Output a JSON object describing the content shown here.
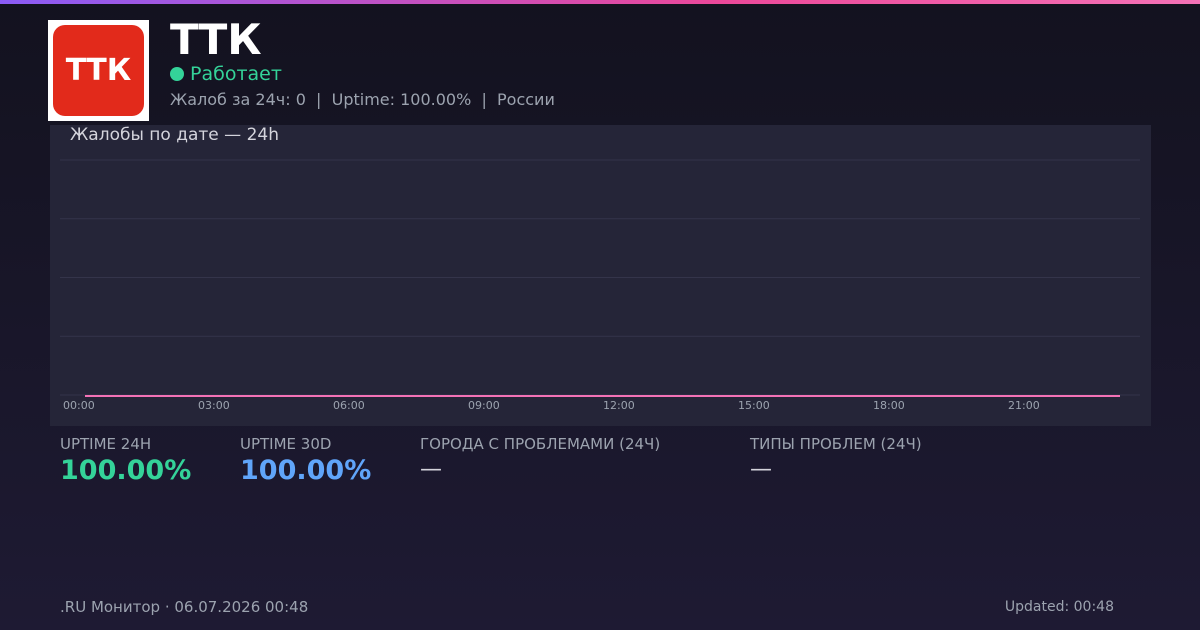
{
  "brand": {
    "logo_text": "ТТК",
    "name": "ТТК",
    "status": "Работает",
    "status_color": "#34d399",
    "meta": "Жалоб за 24ч: 0  |  Uptime: 100.00%  |  России"
  },
  "chart_data": {
    "type": "line",
    "title": "Жалобы по дате — 24h",
    "x": [
      "00:00",
      "01:00",
      "02:00",
      "03:00",
      "04:00",
      "05:00",
      "06:00",
      "07:00",
      "08:00",
      "09:00",
      "10:00",
      "11:00",
      "12:00",
      "13:00",
      "14:00",
      "15:00",
      "16:00",
      "17:00",
      "18:00",
      "19:00",
      "20:00",
      "21:00",
      "22:00",
      "23:00"
    ],
    "tick_labels": [
      "00:00",
      "03:00",
      "06:00",
      "09:00",
      "12:00",
      "15:00",
      "18:00",
      "21:00"
    ],
    "values": [
      0,
      0,
      0,
      0,
      0,
      0,
      0,
      0,
      0,
      0,
      0,
      0,
      0,
      0,
      0,
      0,
      0,
      0,
      0,
      0,
      0,
      0,
      0,
      0
    ],
    "series_color": "#f472b6",
    "grid": true
  },
  "stats": [
    {
      "label": "UPTIME 24H",
      "value": "100.00%",
      "color": "#34d399"
    },
    {
      "label": "UPTIME 30D",
      "value": "100.00%",
      "color": "#60a5fa"
    },
    {
      "label": "ГОРОДА С ПРОБЛЕМАМИ (24Ч)",
      "value": "—"
    },
    {
      "label": "ТИПЫ ПРОБЛЕМ (24Ч)",
      "value": "—"
    }
  ],
  "footer": {
    "left": ".RU Монитор · 06.07.2026 00:48",
    "right": "Updated: 00:48"
  }
}
